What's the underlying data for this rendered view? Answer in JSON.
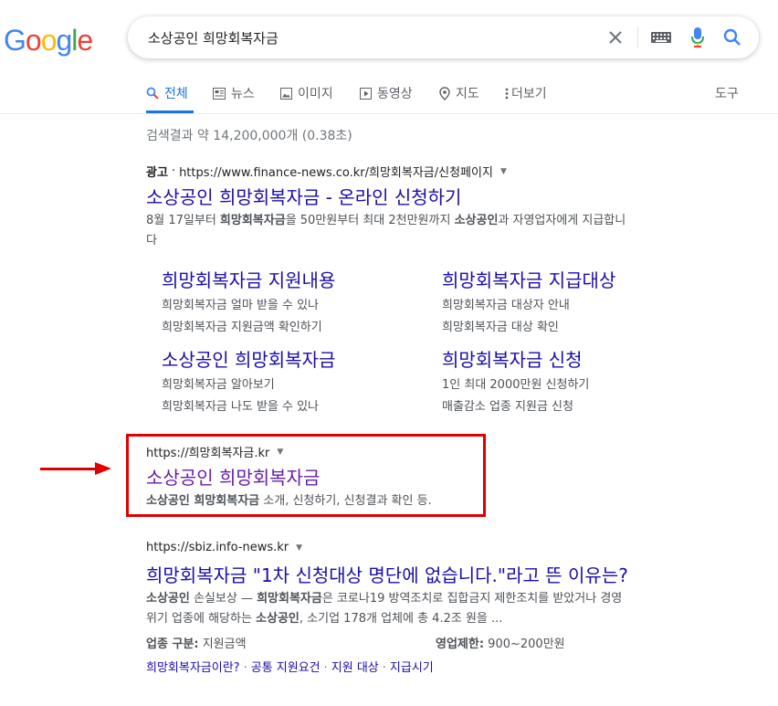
{
  "logo": {
    "letters": [
      "G",
      "o",
      "o",
      "g",
      "l",
      "e"
    ],
    "colors": [
      "#4285f4",
      "#ea4335",
      "#fbbc05",
      "#4285f4",
      "#34a853",
      "#ea4335"
    ]
  },
  "search": {
    "query": "소상공인 희망회복자금"
  },
  "icons": {
    "clear": "close-icon",
    "keyboard": "keyboard-icon",
    "mic": "mic-icon",
    "search": "search-icon"
  },
  "tabs": [
    {
      "label": "전체",
      "icon": "search-icon"
    },
    {
      "label": "뉴스",
      "icon": "news-icon"
    },
    {
      "label": "이미지",
      "icon": "image-icon"
    },
    {
      "label": "동영상",
      "icon": "video-icon"
    },
    {
      "label": "지도",
      "icon": "map-pin-icon"
    },
    {
      "label": "더보기",
      "icon": "more-vert-icon"
    }
  ],
  "tools_label": "도구",
  "stats": "검색결과 약 14,200,000개 (0.38초)",
  "ad": {
    "badge": "광고",
    "dot": "·",
    "url": "https://www.finance-news.co.kr/희망회복자금/신청페이지",
    "title": "소상공인 희망회복자금 - 온라인 신청하기",
    "snippet": {
      "p1": "8월 17일부터 ",
      "b1": "희망회복자금",
      "p2": "을 50만원부터 최대 2천만원까지 ",
      "b2": "소상공인",
      "p3": "과 자영업자에게 지급합니",
      "line2": "다"
    },
    "sitelinks": [
      {
        "title": "희망회복자금 지원내용",
        "lines": [
          "희망회복자금 얼마 받을 수 있나",
          "희망회복자금 지원금액 확인하기"
        ]
      },
      {
        "title": "희망회복자금 지급대상",
        "lines": [
          "희망회복자금 대상자 안내",
          "희망회복자금 대상 확인"
        ]
      },
      {
        "title": "소상공인 희망회복자금",
        "lines": [
          "희망회복자금 알아보기",
          "희망회복자금 나도 받을 수 있나"
        ]
      },
      {
        "title": "희망회복자금 신청",
        "lines": [
          "1인 최대 2000만원 신청하기",
          "매출감소 업종 지원금 신청"
        ]
      }
    ]
  },
  "result1": {
    "url": "https://희망회복자금.kr",
    "title": "소상공인 희망회복자금",
    "snippet": {
      "b1": "소상공인 희망회복자금",
      "p1": " 소개, 신청하기, 신청결과 확인 등."
    }
  },
  "result2": {
    "url": "https://sbiz.info-news.kr",
    "title": "희망회복자금 \"1차 신청대상 명단에 없습니다.\"라고 뜬 이유는?",
    "snippet": {
      "b1": "소상공인",
      "p1": " 손실보상 — ",
      "b2": "희망회복자금",
      "p2": "은 코로나19 방역조치로 집합금지 제한조치를 받았거나 경영",
      "p3": "위기 업종에 해당하는 ",
      "b3": "소상공인",
      "p4": ", 소기업 178개 업체에 총 4.2조 원을 ..."
    },
    "meta": [
      {
        "key": "업종 구분:",
        "value": " 지원금액"
      },
      {
        "key": "영업제한:",
        "value": " 900~200만원"
      }
    ],
    "links": [
      "희망회복자금이란?",
      "공통 지원요건",
      "지원 대상",
      "지급시기"
    ],
    "link_sep": "·"
  },
  "annotation_color": "#e00000"
}
